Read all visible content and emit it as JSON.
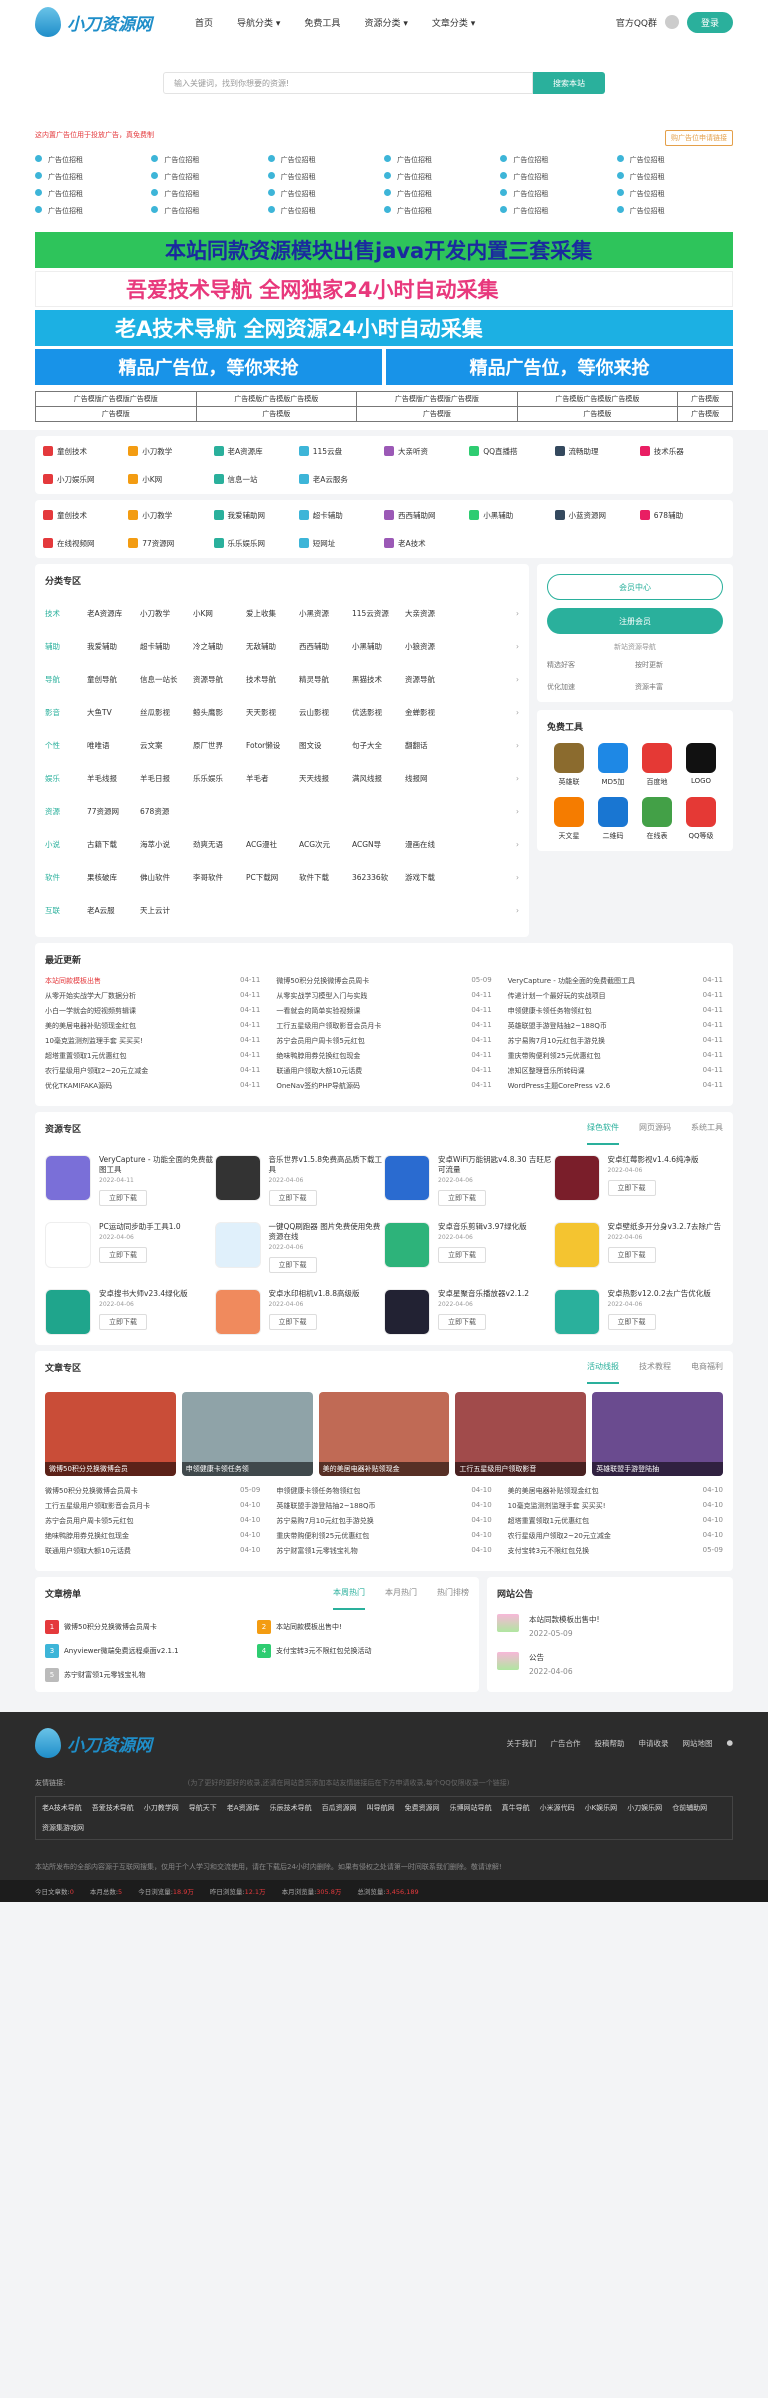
{
  "header": {
    "logo": "小刀资源网",
    "nav": [
      "首页",
      "导航分类",
      "免费工具",
      "资源分类",
      "文章分类"
    ],
    "qq": "官方QQ群",
    "login": "登录"
  },
  "search": {
    "placeholder": "输入关键词，找到你想要的资源!",
    "button": "搜索本站"
  },
  "ads": {
    "tip": "这内置广告位用于投放广告，真免费制",
    "apply": "购广告位申请链接",
    "cells": [
      "广告位招租",
      "广告位招租",
      "广告位招租",
      "广告位招租",
      "广告位招租",
      "广告位招租",
      "广告位招租",
      "广告位招租",
      "广告位招租",
      "广告位招租",
      "广告位招租",
      "广告位招租",
      "广告位招租",
      "广告位招租",
      "广告位招租",
      "广告位招租",
      "广告位招租",
      "广告位招租",
      "广告位招租",
      "广告位招租",
      "广告位招租",
      "广告位招租",
      "广告位招租",
      "广告位招租"
    ]
  },
  "banners": [
    "本站同款资源模块出售java开发内置三套采集",
    "吾爱技术导航 全网独家24小时自动采集",
    "老A技术导航 全网资源24小时自动采集",
    "精品广告位，等你来抢",
    "精品广告位，等你来抢"
  ],
  "table": [
    [
      "广告模版广告模版广告模版",
      "广告模版广告模版广告模版",
      "广告模版广告模版广告模版",
      "广告模版广告模版广告模版",
      "广告模版"
    ],
    [
      "广告模版",
      "广告模版",
      "广告模版",
      "广告模版",
      "广告模版"
    ]
  ],
  "links1": [
    "童创技术",
    "小刀教学",
    "老A资源库",
    "115云盘",
    "大亲听资",
    "QQ直播搭",
    "流畅助理",
    "技术乐器",
    "小刀娱乐网",
    "小K网",
    "信息一站",
    "老A云服务"
  ],
  "links2": [
    "童创技术",
    "小刀教学",
    "我爱辅助网",
    "超卡辅助",
    "西西辅助网",
    "小黑辅助",
    "小蓝资源网",
    "678辅助",
    "在线视频网",
    "77资源网",
    "乐乐娱乐网",
    "短网址",
    "老A技术"
  ],
  "cat": {
    "title": "分类专区",
    "rows": [
      {
        "h": "技术",
        "items": [
          "老A资源库",
          "小刀教学",
          "小K网",
          "爱上收集",
          "小黑资源",
          "115云资源",
          "大亲资源"
        ]
      },
      {
        "h": "辅助",
        "items": [
          "我爱辅助",
          "超卡辅助",
          "冷之辅助",
          "无敌辅助",
          "西西辅助",
          "小黑辅助",
          "小狼资源"
        ]
      },
      {
        "h": "导航",
        "items": [
          "童创导航",
          "信息一站长",
          "资源导航",
          "技术导航",
          "精灵导航",
          "黑猫技术",
          "资源导航"
        ]
      },
      {
        "h": "影音",
        "items": [
          "大鱼TV",
          "丝瓜影视",
          "鲸头鹰影",
          "天天影视",
          "云山影视",
          "优选影视",
          "金蝉影视"
        ]
      },
      {
        "h": "个性",
        "items": [
          "唯唯语",
          "云文案",
          "原厂世界",
          "Fotor懒设",
          "图文设",
          "句子大全",
          "翻翻话"
        ]
      },
      {
        "h": "娱乐",
        "items": [
          "羊毛线报",
          "羊毛日报",
          "乐乐娱乐",
          "羊毛者",
          "天天线报",
          "满风线报",
          "线报网"
        ]
      },
      {
        "h": "资源",
        "items": [
          "77资源网",
          "678资源"
        ]
      },
      {
        "h": "小说",
        "items": [
          "古籍下载",
          "海萃小说",
          "劲爽无语",
          "ACG漫社",
          "ACG次元",
          "ACGN导",
          "漫画在线"
        ]
      },
      {
        "h": "软件",
        "items": [
          "果核破库",
          "佛山软件",
          "李哥软件",
          "PC下载网",
          "软件下载",
          "362336软",
          "游戏下载"
        ]
      },
      {
        "h": "互联",
        "items": [
          "老A云服",
          "天上云计"
        ]
      }
    ]
  },
  "side": {
    "member": "会员中心",
    "register": "注册会员",
    "newsign": "新站资源导航",
    "grid": [
      "精选好客",
      "按时更新",
      "优化加速",
      "资源丰富"
    ],
    "tools_title": "免费工具",
    "tools": [
      "英雄联",
      "MD5加",
      "百度地",
      "LOGO",
      "天文星",
      "二维码",
      "在线表",
      "QQ等级"
    ]
  },
  "latest": {
    "title": "最近更新",
    "items": [
      [
        "本站同款模板出售",
        "04-11"
      ],
      [
        "微博50积分兑换微博会员周卡",
        "05-09"
      ],
      [
        "VeryCapture - 功能全面的免费截图工具",
        "04-11"
      ],
      [
        "从零开始实战学大厂数据分析",
        "04-11"
      ],
      [
        "从零实战学习模型入门与实践",
        "04-11"
      ],
      [
        "传递计划一个最好玩的实战项目",
        "04-11"
      ],
      [
        "小白一学就会的短视频剪辑课",
        "04-11"
      ],
      [
        "一看就会的简单实验视频课",
        "04-11"
      ],
      [
        "申领健康卡领任务物领红包",
        "04-11"
      ],
      [
        "美的美居电器补贴领现金红包",
        "04-11"
      ],
      [
        "工行五星级用户领取影音会员月卡",
        "04-11"
      ],
      [
        "英雄联盟手游登陆抽2~188Q币",
        "04-11"
      ],
      [
        "10毫克监测剂监理手套 买买买!",
        "04-11"
      ],
      [
        "苏宁会员用户周卡领5元红包",
        "04-11"
      ],
      [
        "苏宁易购7月10元红包手游兑换",
        "04-11"
      ],
      [
        "超塔重置领取1元优惠红包",
        "04-11"
      ],
      [
        "绝味鸭脖用券兑换红包现金",
        "04-11"
      ],
      [
        "重庆带购便利领25元优惠红包",
        "04-11"
      ],
      [
        "农行星级用户领取2~20元立减金",
        "04-11"
      ],
      [
        "联通用户领取大额10元话费",
        "04-11"
      ],
      [
        "凉知区整理音乐所转码课",
        "04-11"
      ],
      [
        "优化TKAMIFAKA源码",
        "04-11"
      ],
      [
        "OneNav签约PHP导航源码",
        "04-11"
      ],
      [
        "WordPress主题CorePress v2.6",
        "04-11"
      ]
    ]
  },
  "resources": {
    "title": "资源专区",
    "tabs": [
      "绿色软件",
      "网页源码",
      "系统工具"
    ],
    "items": [
      [
        "VeryCapture - 功能全面的免费截图工具",
        "2022-04-11"
      ],
      [
        "音乐世界v1.5.8免费高品质下载工具",
        "2022-04-06"
      ],
      [
        "安卓WiFi万能钥匙v4.8.30 吉旺尼可流量",
        "2022-04-06"
      ],
      [
        "安卓红莓影视v1.4.6纯净版",
        "2022-04-06"
      ],
      [
        "PC运动同步助手工具1.0",
        "2022-04-06"
      ],
      [
        "一键QQ刷跑器 图片免费使用免费资源在线",
        "2022-04-06"
      ],
      [
        "安卓音乐剪辑v3.97绿化版",
        "2022-04-06"
      ],
      [
        "安卓壁纸多开分身v3.2.7去除广告",
        "2022-04-06"
      ],
      [
        "安卓搜书大师v23.4绿化版",
        "2022-04-06"
      ],
      [
        "安卓水印相机v1.8.8高级版",
        "2022-04-06"
      ],
      [
        "安卓星聚音乐播放器v2.1.2",
        "2022-04-06"
      ],
      [
        "安卓热影v12.0.2去广告优化版",
        "2022-04-06"
      ]
    ]
  },
  "articles": {
    "title": "文章专区",
    "tabs": [
      "活动线报",
      "技术教程",
      "电商福利"
    ],
    "cards": [
      "微博50积分兑换微博会员",
      "申领健康卡领任务领",
      "美的美居电器补贴领现金",
      "工行五星级用户领取影音",
      "英雄联盟手游登陆抽"
    ],
    "list": [
      [
        "微博50积分兑换微博会员周卡",
        "05-09"
      ],
      [
        "申领健康卡领任务物领红包",
        "04-10"
      ],
      [
        "美的美居电器补贴领现金红包",
        "04-10"
      ],
      [
        "工行五星级用户领取影音会员月卡",
        "04-10"
      ],
      [
        "英雄联盟手游登陆抽2~188Q币",
        "04-10"
      ],
      [
        "10毫克监测剂监理手套 买买买!",
        "04-10"
      ],
      [
        "苏宁会员用户周卡领5元红包",
        "04-10"
      ],
      [
        "苏宁易购7月10元红包手游兑换",
        "04-10"
      ],
      [
        "超塔重置领取1元优惠红包",
        "04-10"
      ],
      [
        "绝味鸭脖用券兑换红包现金",
        "04-10"
      ],
      [
        "重庆带购便利领25元优惠红包",
        "04-10"
      ],
      [
        "农行星级用户领取2~20元立减金",
        "04-10"
      ],
      [
        "联通用户领取大额10元话费",
        "04-10"
      ],
      [
        "苏宁财富领1元零钱宝礼物",
        "04-10"
      ],
      [
        "支付宝转3元不限红包兑换",
        "05-09"
      ]
    ]
  },
  "rank": {
    "title": "文章榜单",
    "tabs": [
      "本周热门",
      "本月热门",
      "热门排榜"
    ],
    "items": [
      "微博50积分兑换微博会员周卡",
      "本站同款模板出售中!",
      "Anyviewer微端免费远程桌面v2.1.1",
      "支付宝转3元不限红包兑换活动",
      "苏宁财富领1元零钱宝礼物"
    ]
  },
  "notice": {
    "title": "网站公告",
    "items": [
      [
        "本站同款模板出售中!",
        "2022-05-09"
      ],
      [
        "公告",
        "2022-04-06"
      ]
    ]
  },
  "footer": {
    "logo": "小刀资源网",
    "nav": [
      "关于我们",
      "广告合作",
      "投稿帮助",
      "申请收录",
      "网站地图"
    ],
    "friend_label": "友情链接:",
    "friend_note": "(为了更好的更好的收录,还请在网站首页添加本站友情链接后在下方申请收录,每个QQ仅限收录一个链接)",
    "friends": [
      "老A技术导航",
      "吾爱技术导航",
      "小刀教学网",
      "导航天下",
      "老A资源库",
      "乐辰技术导航",
      "百瓜资源网",
      "叫导航网",
      "免费资源网",
      "乐博网站导航",
      "真牛导航",
      "小米源代码",
      "小K娱乐网",
      "小刀娱乐网",
      "仓前辅助网",
      "资源集游戏网"
    ],
    "copy": "本站所发布的全部内容源于互联网搜集，仅用于个人学习和交流使用，请在下载后24小时内删除。如果有侵权之处请第一时间联系我们删除。敬请谅解!",
    "bar": [
      "今日文章数:",
      "0",
      "本月总数:",
      "5",
      "今日浏览量:",
      "18.9万",
      "昨日浏览量:",
      "12.1万",
      "本月浏览量:",
      "305.8万",
      "总浏览量:",
      "3,456,189"
    ]
  }
}
